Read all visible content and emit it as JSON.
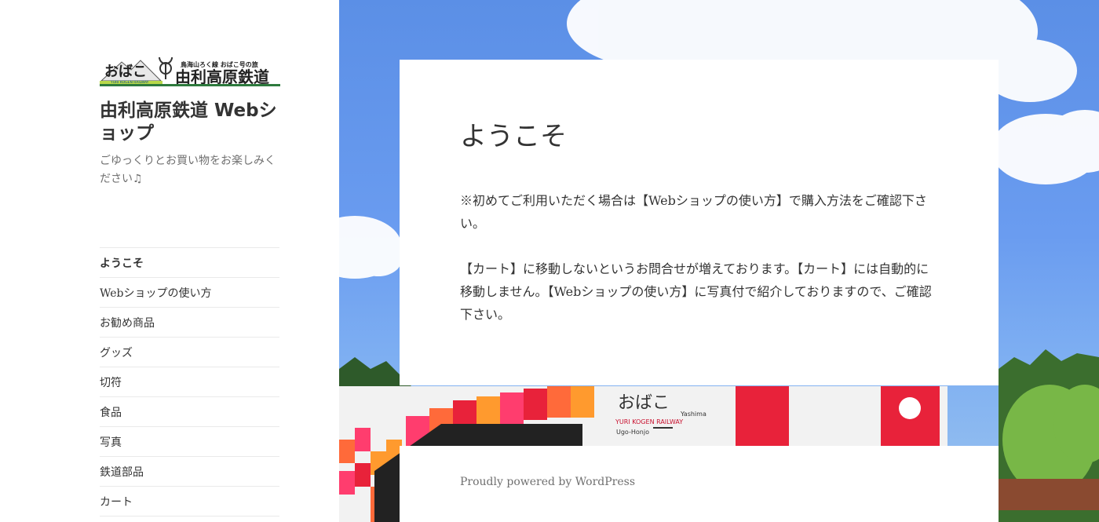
{
  "site": {
    "logo_text_main": "由利高原鉄道",
    "logo_text_brand": "おばこ",
    "logo_text_sub": "鳥海山ろく線 おばこ号の旅",
    "logo_text_railway": "YURI KOGEN RAILWAY",
    "title": "由利高原鉄道 Webショップ",
    "tagline": "ごゆっくりとお買い物をお楽しみください♫"
  },
  "nav": {
    "items": [
      {
        "label": "ようこそ"
      },
      {
        "label": "Webショップの使い方"
      },
      {
        "label": "お勧め商品"
      },
      {
        "label": "グッズ"
      },
      {
        "label": "切符"
      },
      {
        "label": "食品"
      },
      {
        "label": "写真"
      },
      {
        "label": "鉄道部品"
      },
      {
        "label": "カート"
      }
    ]
  },
  "main": {
    "heading": "ようこそ",
    "paragraph1": "※初めてご利用いただく場合は【Webショップの使い方】で購入方法をご確認下さい。",
    "paragraph2": "【カート】に移動しないというお問合せが増えております。【カート】には自動的に移動しません。【Webショップの使い方】に写真付で紹介しておりますので、ご確認下さい。"
  },
  "train_sign": {
    "brand": "おばこ",
    "railway": "YURI KOGEN RAILWAY",
    "left_station": "Ugo-Honjo",
    "right_station": "Yashima"
  },
  "footer": {
    "text": "Proudly powered by WordPress"
  },
  "colors": {
    "accent": "#333333",
    "sky": "#5b8fe6"
  }
}
